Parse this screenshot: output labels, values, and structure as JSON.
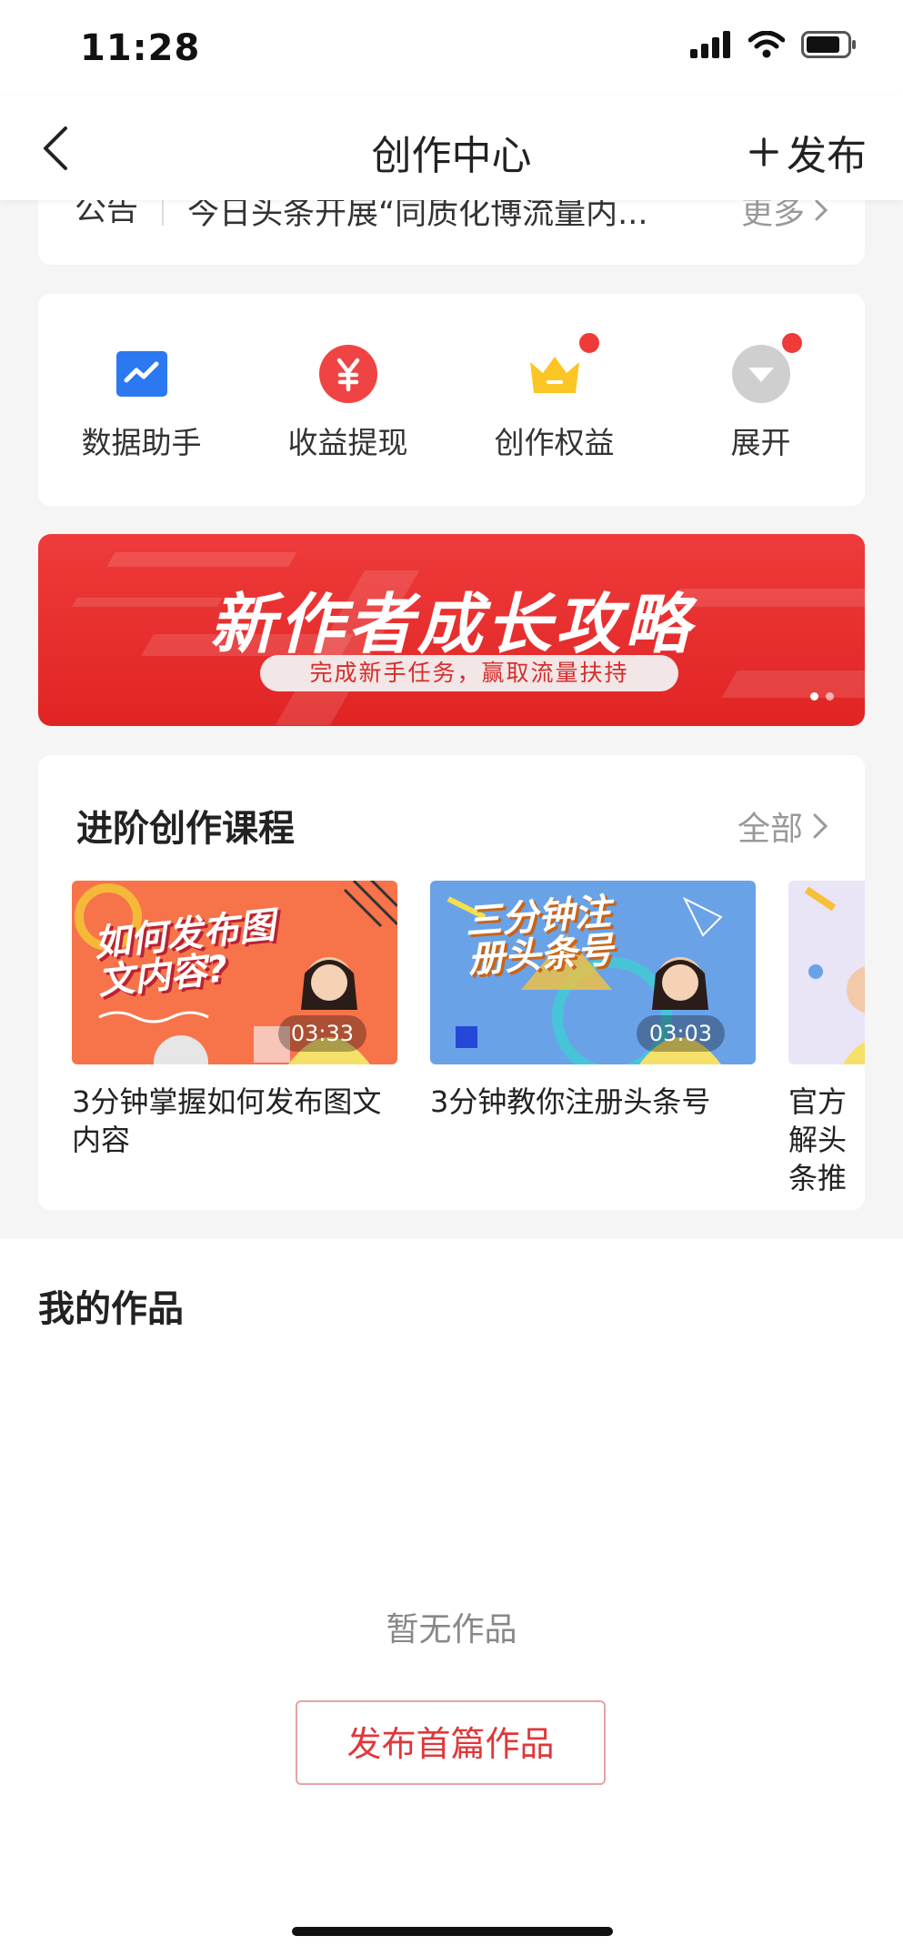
{
  "status_bar": {
    "time": "11:28"
  },
  "nav": {
    "title": "创作中心",
    "publish_label": "发布"
  },
  "notice": {
    "label": "公告",
    "text": "今日头条开展“同质化博流量内...",
    "more_label": "更多"
  },
  "tools": [
    {
      "label": "数据助手",
      "icon": "chart-icon",
      "has_dot": false
    },
    {
      "label": "收益提现",
      "icon": "yuan-icon",
      "has_dot": false
    },
    {
      "label": "创作权益",
      "icon": "crown-icon",
      "has_dot": true
    },
    {
      "label": "展开",
      "icon": "expand-icon",
      "has_dot": true
    }
  ],
  "banner": {
    "title": "新作者成长攻略",
    "subtitle": "完成新手任务，赢取流量扶持"
  },
  "courses": {
    "title": "进阶创作课程",
    "all_label": "全部",
    "items": [
      {
        "thumb_text": "如何发布图文内容?",
        "duration": "03:33",
        "name": "3分钟掌握如何发布图文内容"
      },
      {
        "thumb_text": "三分钟注册头条号",
        "duration": "03:03",
        "name": "3分钟教你注册头条号"
      },
      {
        "thumb_text": "",
        "duration": "",
        "name": "官方解头条推"
      }
    ]
  },
  "works": {
    "title": "我的作品",
    "empty_text": "暂无作品",
    "first_button_label": "发布首篇作品"
  },
  "colors": {
    "accent": "#e0373a",
    "banner": "#e62b2b",
    "page_bg": "#f5f5f5"
  }
}
